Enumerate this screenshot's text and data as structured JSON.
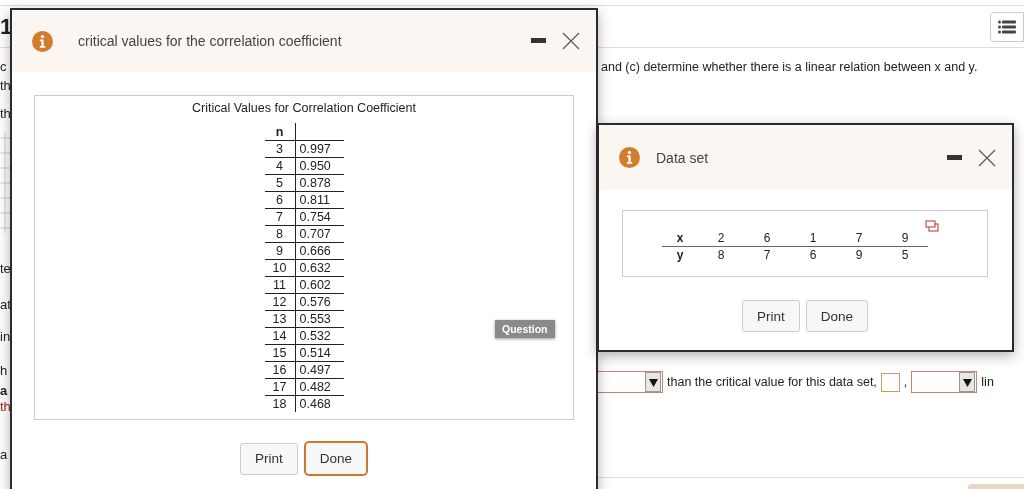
{
  "page": {
    "step_number": "1",
    "question_text": "and (c) determine whether there is a linear relation between x and y.",
    "left_fragments": [
      {
        "text": "c",
        "kind": "plain"
      },
      {
        "text": "th",
        "kind": "plain"
      },
      {
        "text": "th",
        "kind": "plain"
      },
      {
        "text": "te",
        "kind": "plain"
      },
      {
        "text": "at",
        "kind": "plain"
      },
      {
        "text": "in",
        "kind": "plain"
      },
      {
        "text": "h",
        "kind": "plain"
      },
      {
        "text": "a",
        "kind": "bold"
      },
      {
        "text": "th",
        "kind": "red"
      },
      {
        "text": "a",
        "kind": "plain"
      }
    ],
    "answer_row": [
      {
        "kind": "dropdown"
      },
      {
        "kind": "text",
        "text": "than the critical value for this data set,"
      },
      {
        "kind": "box"
      },
      {
        "kind": "text",
        "text": ","
      },
      {
        "kind": "dropdown"
      },
      {
        "kind": "text",
        "text": "lin"
      }
    ]
  },
  "critical_dialog": {
    "title": "critical values for the correlation coefficient",
    "table_title": "Critical Values for Correlation Coefficient",
    "column_header": "n",
    "rows": [
      {
        "n": "3",
        "value": "0.997"
      },
      {
        "n": "4",
        "value": "0.950"
      },
      {
        "n": "5",
        "value": "0.878"
      },
      {
        "n": "6",
        "value": "0.811"
      },
      {
        "n": "7",
        "value": "0.754"
      },
      {
        "n": "8",
        "value": "0.707"
      },
      {
        "n": "9",
        "value": "0.666"
      },
      {
        "n": "10",
        "value": "0.632"
      },
      {
        "n": "11",
        "value": "0.602"
      },
      {
        "n": "12",
        "value": "0.576"
      },
      {
        "n": "13",
        "value": "0.553"
      },
      {
        "n": "14",
        "value": "0.532"
      },
      {
        "n": "15",
        "value": "0.514"
      },
      {
        "n": "16",
        "value": "0.497"
      },
      {
        "n": "17",
        "value": "0.482"
      },
      {
        "n": "18",
        "value": "0.468"
      }
    ],
    "badge": "Question",
    "buttons": [
      {
        "label": "Print",
        "focused": false
      },
      {
        "label": "Done",
        "focused": true
      }
    ]
  },
  "data_dialog": {
    "title": "Data set",
    "rows": [
      {
        "label": "x",
        "values": [
          "2",
          "6",
          "1",
          "7",
          "9"
        ]
      },
      {
        "label": "y",
        "values": [
          "8",
          "7",
          "6",
          "9",
          "5"
        ]
      }
    ],
    "buttons": [
      {
        "label": "Print",
        "focused": false
      },
      {
        "label": "Done",
        "focused": false
      }
    ]
  }
}
